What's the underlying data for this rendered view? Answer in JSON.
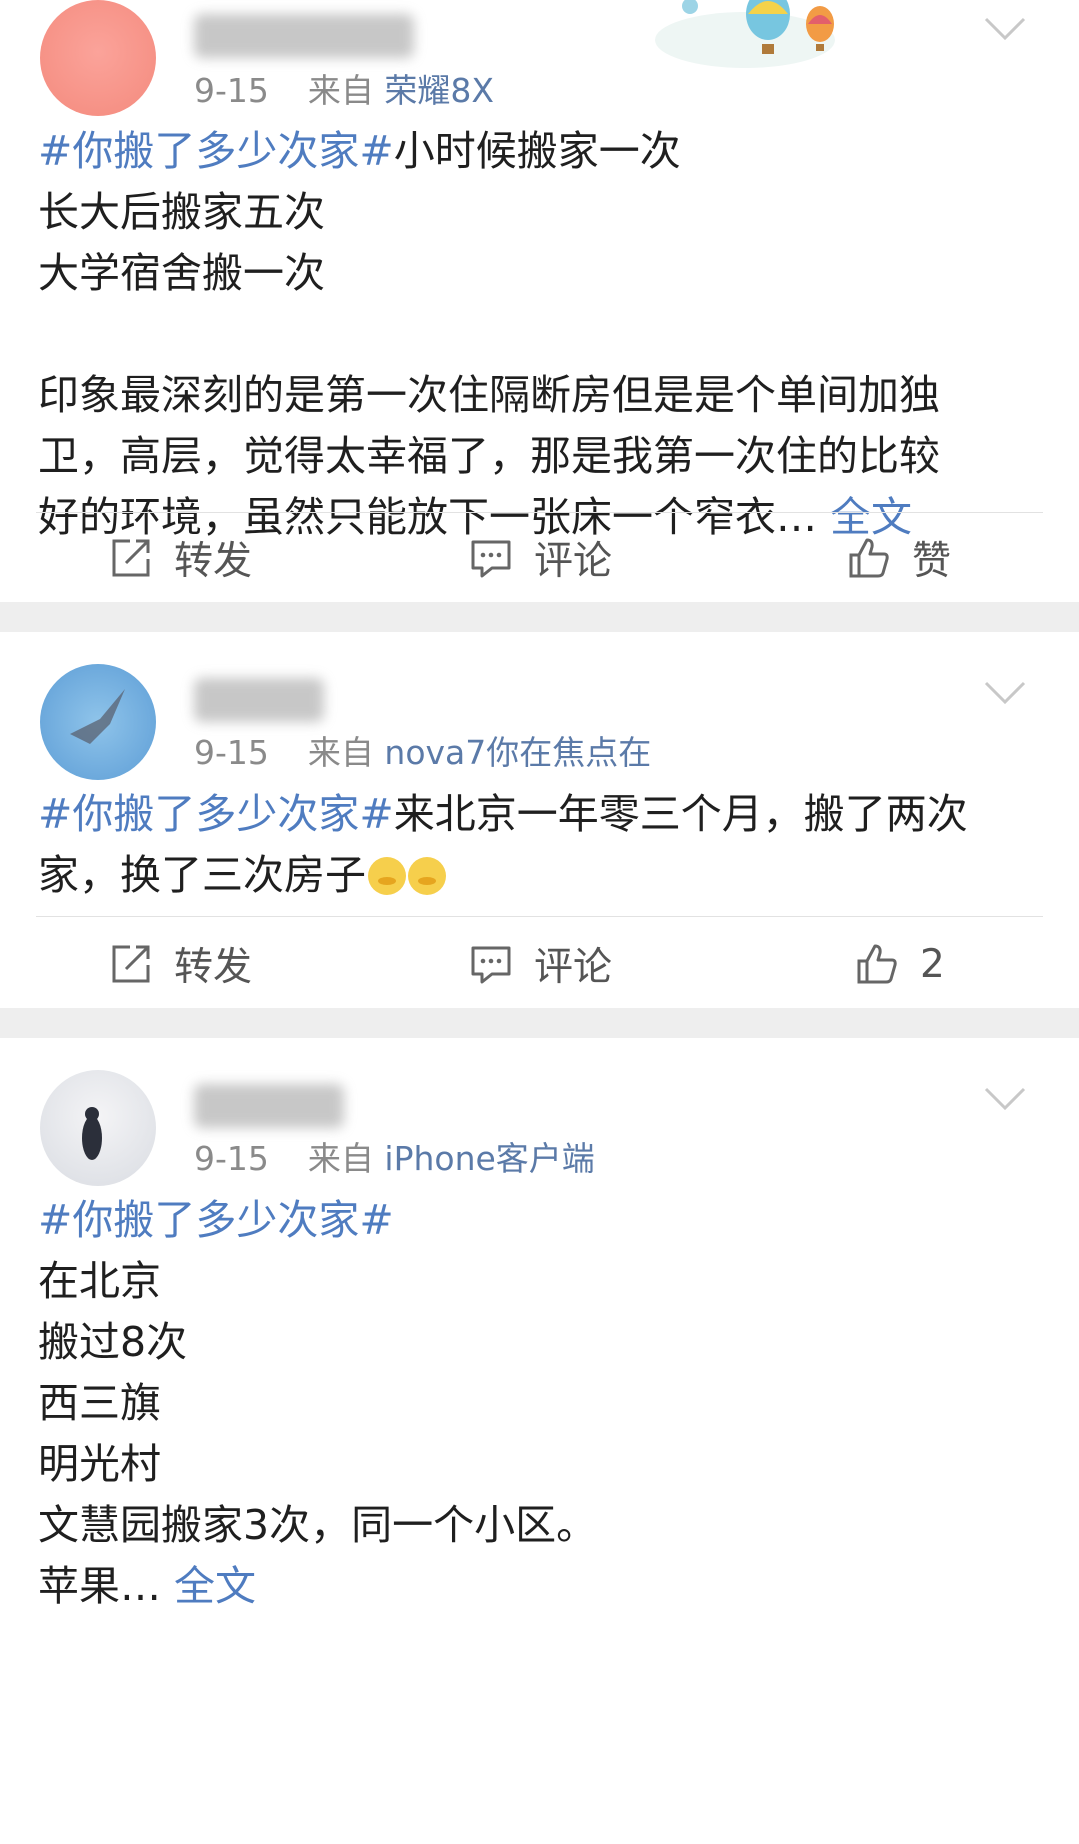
{
  "posts": [
    {
      "date": "9-15",
      "from_label": "来自",
      "source": "荣耀8X",
      "lines": [
        {
          "topic": "#你搬了多少次家#",
          "text": "小时候搬家一次"
        },
        {
          "text": "长大后搬家五次"
        },
        {
          "text": "大学宿舍搬一次"
        },
        {
          "text": ""
        },
        {
          "text": "印象最深刻的是第一次住隔断房但是是个单间加独"
        },
        {
          "text": "卫，高层，觉得太幸福了，那是我第一次住的比较"
        },
        {
          "text": "好的环境，虽然只能放下一张床一个窄衣…",
          "more": "全文"
        }
      ],
      "actions": {
        "repost": "转发",
        "comment": "评论",
        "like": "赞"
      }
    },
    {
      "date": "9-15",
      "from_label": "来自",
      "source": "nova7你在焦点在",
      "lines": [
        {
          "topic": "#你搬了多少次家#",
          "text": "来北京一年零三个月，搬了两次"
        },
        {
          "text": "家，换了三次房子",
          "emoji_count": 2
        }
      ],
      "actions": {
        "repost": "转发",
        "comment": "评论",
        "like": "2"
      }
    },
    {
      "date": "9-15",
      "from_label": "来自",
      "source": "iPhone客户端",
      "lines": [
        {
          "topic": "#你搬了多少次家#",
          "text": ""
        },
        {
          "text": "在北京"
        },
        {
          "text": "搬过8次"
        },
        {
          "text": "西三旗"
        },
        {
          "text": "明光村"
        },
        {
          "text": "文慧园搬家3次，同一个小区。"
        },
        {
          "text": "苹果…",
          "more": "全文"
        }
      ]
    }
  ],
  "icons": {
    "repost": "edit-share-icon",
    "comment": "comment-icon",
    "like": "thumbs-up-icon",
    "menu": "chevron-down-icon"
  },
  "colors": {
    "topic": "#4f7cc0",
    "meta": "#8a8a8a",
    "separator": "#eeeeee"
  }
}
